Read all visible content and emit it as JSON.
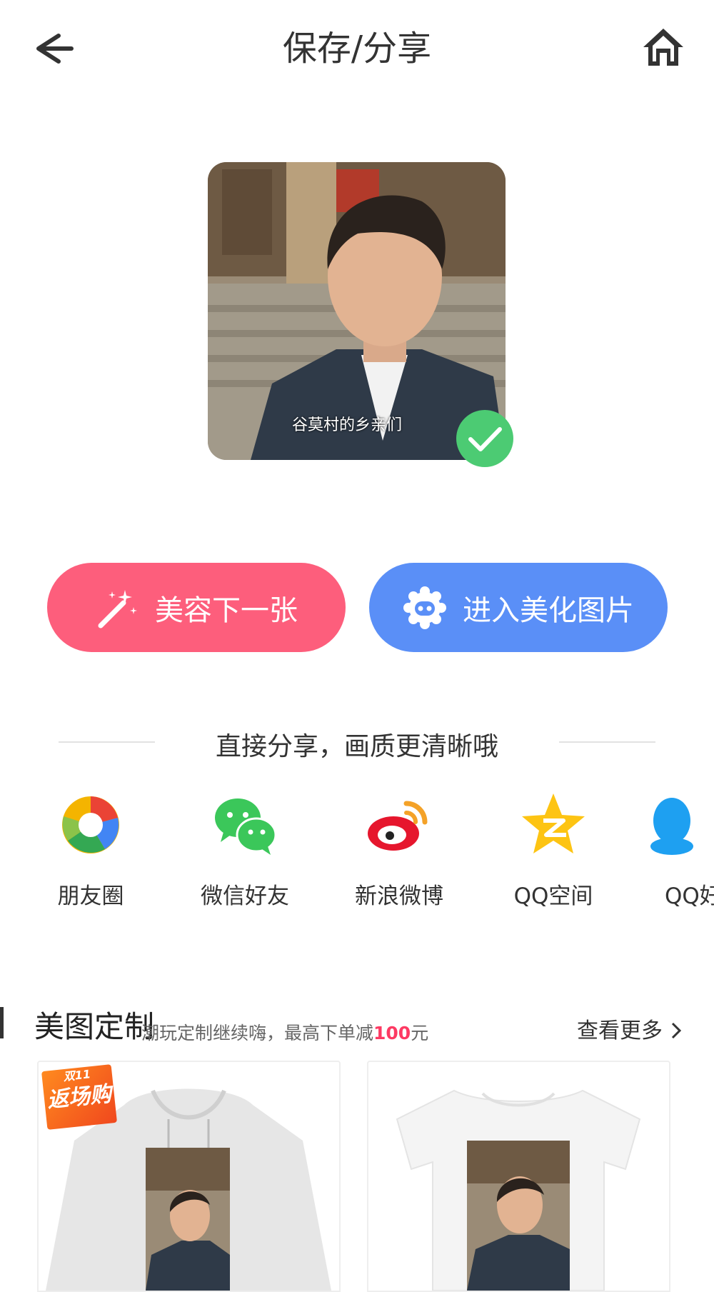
{
  "header": {
    "title": "保存/分享"
  },
  "preview": {
    "caption": "谷莫村的乡亲们"
  },
  "actions": {
    "next_label": "美容下一张",
    "beautify_label": "进入美化图片"
  },
  "share": {
    "heading": "直接分享，画质更清晰哦",
    "items": [
      {
        "label": "朋友圈"
      },
      {
        "label": "微信好友"
      },
      {
        "label": "新浪微博"
      },
      {
        "label": "QQ空间"
      },
      {
        "label": "QQ好友"
      }
    ]
  },
  "custom": {
    "title": "美图定制",
    "subtitle_prefix": "潮玩定制继续嗨，最高下单减",
    "subtitle_amount": "100",
    "subtitle_suffix": "元",
    "more_label": "查看更多",
    "badge_top": "双11",
    "badge_main": "返场购"
  },
  "colors": {
    "pink": "#fd5e7c",
    "blue": "#5a8ff7",
    "check": "#4ccb73"
  }
}
